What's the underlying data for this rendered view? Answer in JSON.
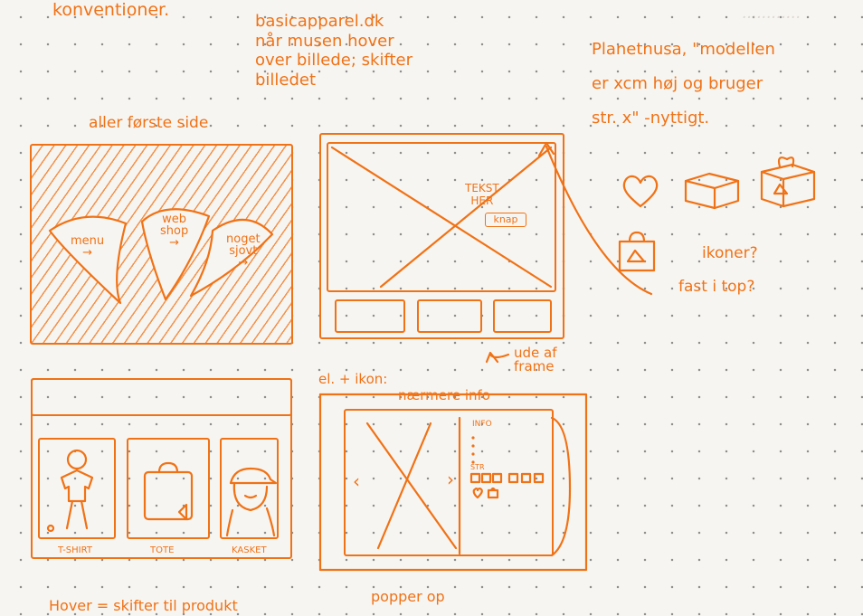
{
  "notes": {
    "top_left": "konventioner.",
    "basic_apparel": [
      "basicapparel.dk",
      "når musen hover",
      "over billede; skifter",
      "billedet"
    ],
    "planetnusa": [
      "Planetnusa, \"modellen",
      "er xcm høj og bruger",
      "str. x\" -nyttigt."
    ],
    "first_page_label": "aller første side",
    "icons_question": "ikoner?",
    "fixed_top": "fast i top?",
    "out_of_frame": [
      "ude af",
      "frame"
    ],
    "el_icon": [
      "el. + ikon:",
      "nærmere info"
    ],
    "hover_note": "Hover = skifter til produkt",
    "popup_note": "popper op"
  },
  "frame1": {
    "cones": [
      {
        "label_lines": [
          "menu",
          "→"
        ]
      },
      {
        "label_lines": [
          "web",
          "shop",
          "→"
        ]
      },
      {
        "label_lines": [
          "noget",
          "sjovt",
          "→"
        ]
      }
    ]
  },
  "frame2": {
    "text_here": [
      "TEKST",
      "HER"
    ],
    "button_label": "knap"
  },
  "frame3": {
    "products": [
      {
        "label": "T-SHIRT"
      },
      {
        "label": "TOTE"
      },
      {
        "label": "KASKET"
      }
    ]
  },
  "frame4": {
    "info_label": "INFO",
    "size_label": "STR",
    "prev_arrow": "‹",
    "next_arrow": "›"
  },
  "icons": [
    "heart-icon",
    "box-icon",
    "gift-bag-icon",
    "bag-icon"
  ]
}
